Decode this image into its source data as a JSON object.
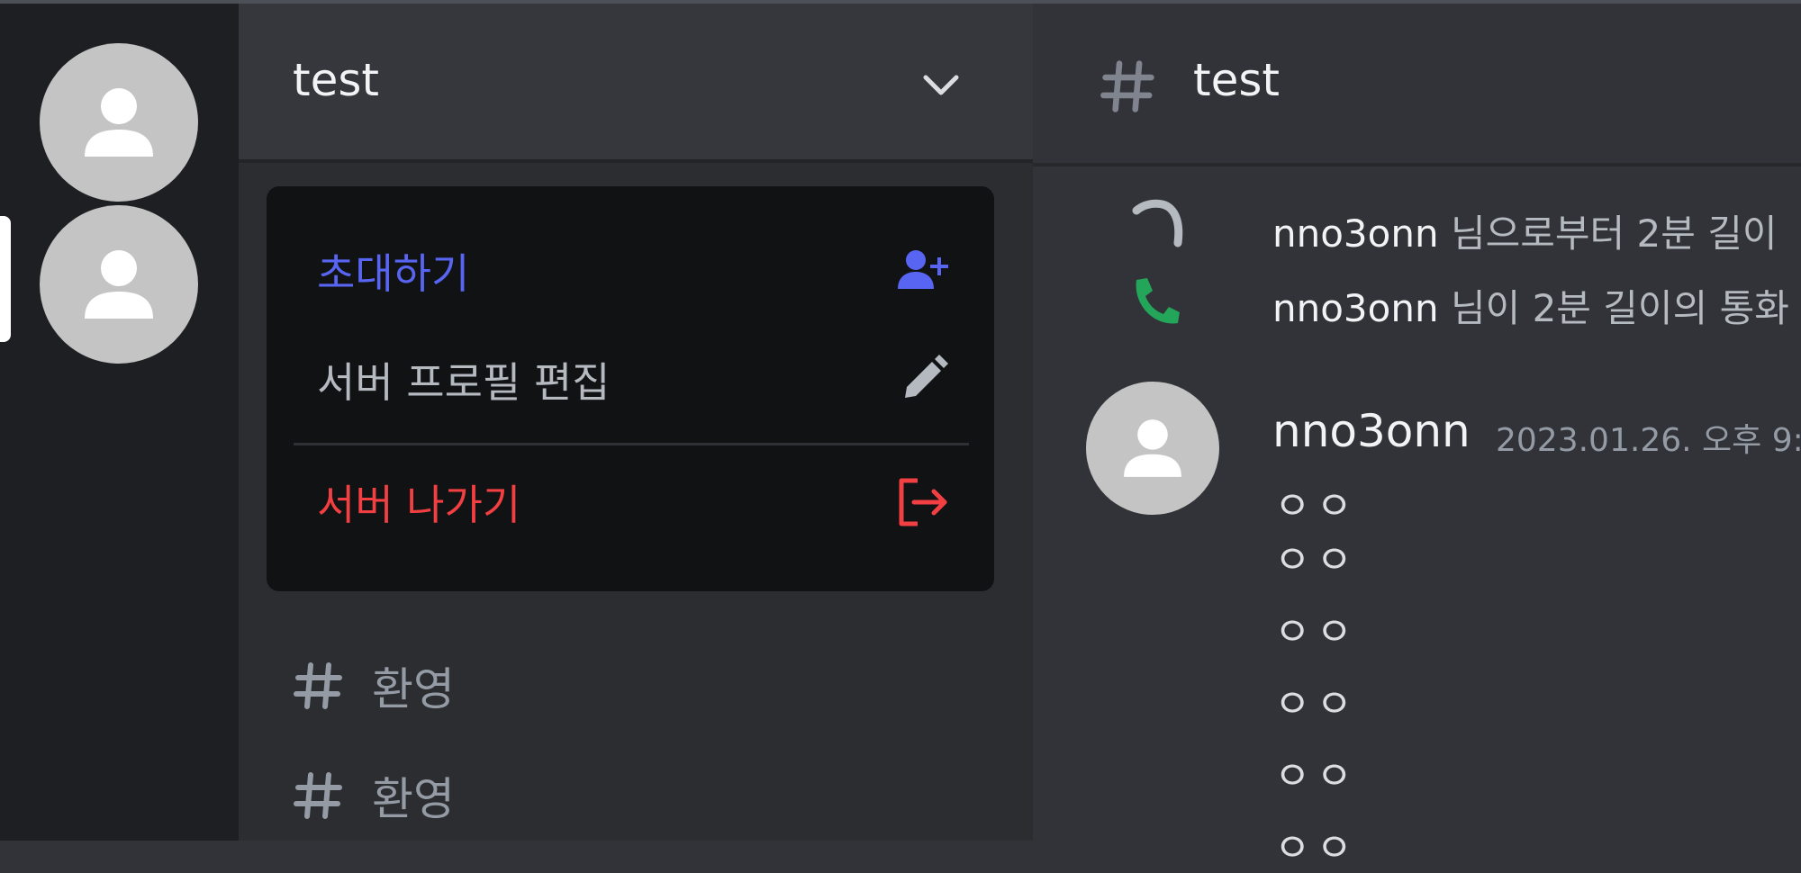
{
  "server": {
    "name": "test"
  },
  "channels": [
    {
      "label": "환영"
    },
    {
      "label": "환영"
    }
  ],
  "menu": {
    "invite": "초대하기",
    "edit_profile": "서버 프로필 편집",
    "leave": "서버 나가기"
  },
  "chat": {
    "channel_name": "test",
    "system_messages": [
      {
        "user": "nno3onn",
        "text": "님으로부터 2분 길이"
      },
      {
        "user": "nno3onn",
        "text": "님이 2분 길이의 통화"
      }
    ],
    "message": {
      "author": "nno3onn",
      "timestamp": "2023.01.26. 오후 9:",
      "lines": [
        "ㅇㅇ",
        "ㅇㅇ",
        "ㅇㅇ",
        "ㅇㅇ",
        "ㅇㅇ",
        "ㅇㅇ"
      ]
    }
  },
  "colors": {
    "invite": "#5865f2",
    "leave": "#f23f42",
    "call_accept": "#23a55a"
  },
  "icons": {
    "chevron": "chevron-down-icon",
    "invite": "person-add-icon",
    "edit": "pencil-icon",
    "leave": "leave-icon",
    "hash": "hash-icon",
    "call_missed": "phone-missed-icon",
    "call": "phone-icon"
  }
}
